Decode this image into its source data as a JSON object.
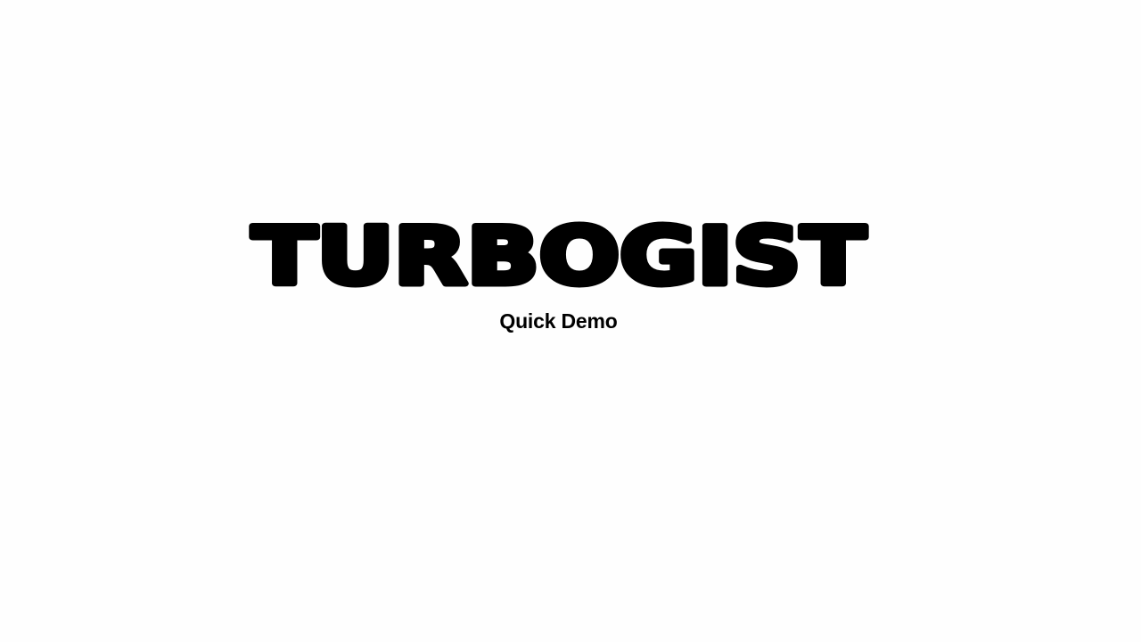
{
  "brand": {
    "logo_text": "TURBOGIST",
    "subtitle": "Quick Demo",
    "text_color": "#000000",
    "background_color": "#fefefe"
  }
}
